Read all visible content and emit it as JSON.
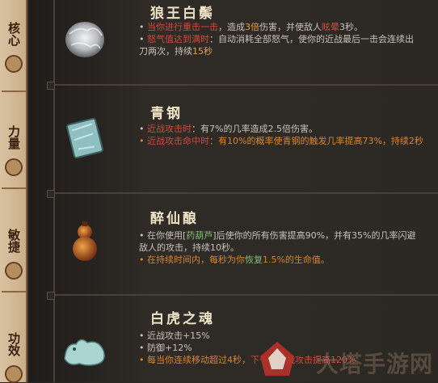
{
  "rail": {
    "tabs": [
      "核心",
      "力量",
      "敏捷",
      "功效"
    ]
  },
  "items": [
    {
      "title": "狼王白鬃",
      "icon": "white-fur-icon",
      "lines": [
        {
          "parts": [
            {
              "t": "• ",
              "c": ""
            },
            {
              "t": "当你进行重击一击",
              "c": "hl"
            },
            {
              "t": "，造成",
              "c": ""
            },
            {
              "t": "3倍",
              "c": "hl-o"
            },
            {
              "t": "伤害，并使敌人",
              "c": ""
            },
            {
              "t": "眩晕",
              "c": "hl"
            },
            {
              "t": "3秒。",
              "c": ""
            }
          ]
        },
        {
          "parts": [
            {
              "t": "• ",
              "c": ""
            },
            {
              "t": "怒气值达到满时",
              "c": "hl"
            },
            {
              "t": "：自动消耗全部怒气，使你的近战最后一击会连续出",
              "c": ""
            }
          ]
        },
        {
          "parts": [
            {
              "t": "刀两次，持续",
              "c": ""
            },
            {
              "t": "15秒",
              "c": "hl-o"
            }
          ]
        }
      ]
    },
    {
      "title": "青钢",
      "icon": "steel-plate-icon",
      "lines": [
        {
          "parts": [
            {
              "t": "• ",
              "c": ""
            },
            {
              "t": "近战攻击时",
              "c": "hl"
            },
            {
              "t": "：有7%的几率造成2.5倍伤害。",
              "c": ""
            }
          ]
        },
        {
          "parts": [
            {
              "t": "• ",
              "c": "orange"
            },
            {
              "t": "近战攻击命中时",
              "c": "hl"
            },
            {
              "t": "：有10%的概率使青钢的触发几率提高73%，持续2秒",
              "c": "orange"
            }
          ]
        }
      ]
    },
    {
      "title": "醉仙酿",
      "icon": "gourd-icon",
      "lines": [
        {
          "parts": [
            {
              "t": "• 在你使用[",
              "c": ""
            },
            {
              "t": "药葫芦",
              "c": "hl-g"
            },
            {
              "t": "]后使你的所有伤害提高90%，并有35%的几率闪避",
              "c": ""
            }
          ]
        },
        {
          "parts": [
            {
              "t": "敌人的攻击，持续10秒。",
              "c": ""
            }
          ]
        },
        {
          "parts": [
            {
              "t": "• 在持续时间内，每秒为你",
              "c": "orange"
            },
            {
              "t": "恢复",
              "c": "hl-g"
            },
            {
              "t": "1.5%的生命值。",
              "c": "orange"
            }
          ]
        }
      ]
    },
    {
      "title": "白虎之魂",
      "icon": "jade-tiger-icon",
      "lines": [
        {
          "parts": [
            {
              "t": "• 近战攻击+15%",
              "c": ""
            }
          ]
        },
        {
          "parts": [
            {
              "t": "• 防御+12%",
              "c": ""
            }
          ]
        },
        {
          "parts": [
            {
              "t": "• 每当你连续移动超过4秒，",
              "c": "orange"
            },
            {
              "t": "下一次近战攻击提高120%",
              "c": "hl"
            }
          ]
        }
      ]
    }
  ],
  "watermark": "大塔手游网"
}
